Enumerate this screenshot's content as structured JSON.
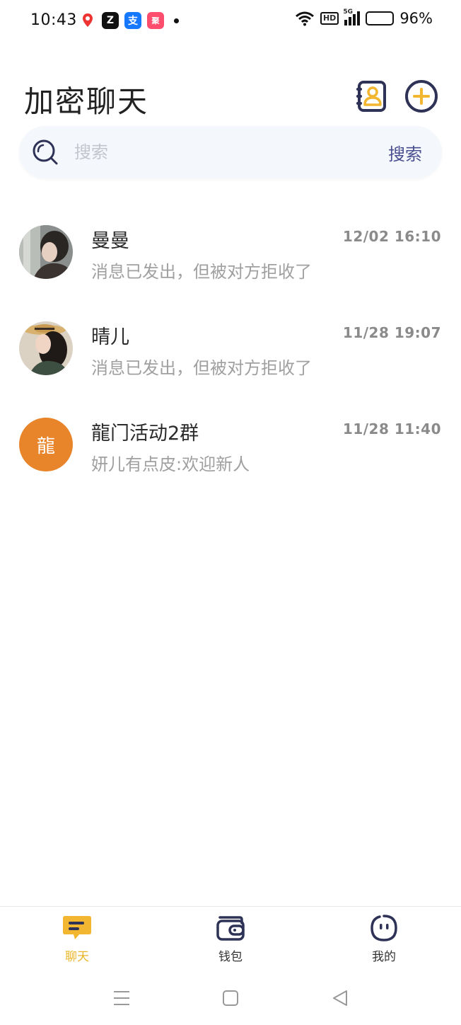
{
  "status_bar": {
    "time": "10:43",
    "network": "5G",
    "hd": "HD",
    "battery": "96%",
    "battery_level": 0.96
  },
  "header": {
    "title": "加密聊天",
    "contacts_icon": "contacts-book-icon",
    "add_icon": "plus-circle-icon"
  },
  "search": {
    "placeholder": "搜索",
    "button_label": "搜索"
  },
  "chats": [
    {
      "name": "曼曼",
      "time": "12/02 16:10",
      "last_message": "消息已发出，但被对方拒收了",
      "avatar_type": "photo"
    },
    {
      "name": "晴儿",
      "time": "11/28 19:07",
      "last_message": "消息已发出，但被对方拒收了",
      "avatar_type": "photo"
    },
    {
      "name": "龍门活动2群",
      "time": "11/28 11:40",
      "last_message": "妍儿有点皮:欢迎新人",
      "avatar_type": "text",
      "avatar_text": "龍",
      "avatar_color": "#e8842a"
    }
  ],
  "bottom_nav": {
    "items": [
      {
        "label": "聊天",
        "icon": "chat-bubble-icon",
        "active": true
      },
      {
        "label": "钱包",
        "icon": "wallet-icon",
        "active": false
      },
      {
        "label": "我的",
        "icon": "smiley-face-icon",
        "active": false
      }
    ]
  },
  "colors": {
    "accent": "#f2b630",
    "primary_dark": "#2e3256",
    "search_text": "#4a4f8f"
  }
}
